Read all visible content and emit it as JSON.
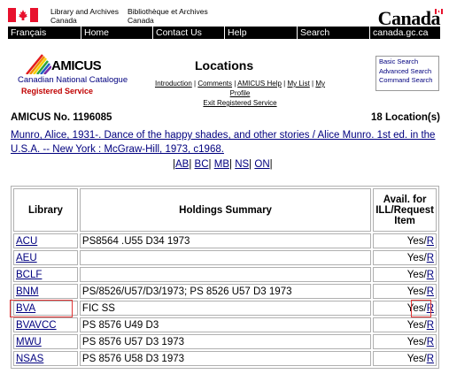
{
  "header": {
    "dept_en": [
      "Library and Archives",
      "Canada"
    ],
    "dept_fr": [
      "Bibliothèque et Archives",
      "Canada"
    ],
    "wordmark": "Canada"
  },
  "nav": [
    "Français",
    "Home",
    "Contact Us",
    "Help",
    "Search",
    "canada.gc.ca"
  ],
  "amicus": {
    "logo_text": "AMICUS",
    "logo_sub": "Canadian National Catalogue",
    "logo_service": "Registered Service",
    "title": "Locations",
    "links": [
      "Introduction",
      "Comments",
      "AMICUS Help",
      "My List",
      "My Profile",
      "Exit Registered Service"
    ],
    "search_links": [
      "Basic Search",
      "Advanced Search",
      "Command Search"
    ]
  },
  "record": {
    "number_label": "AMICUS No. 1196085",
    "location_count": "18 Location(s)",
    "citation": "Munro, Alice, 1931-. Dance of the happy shades, and other stories / Alice Munro. 1st ed. in the U.S.A. -- New York : McGraw-Hill, 1973, c1968.",
    "provinces": [
      "AB",
      "BC",
      "MB",
      "NS",
      "ON"
    ]
  },
  "table": {
    "headers": [
      "Library",
      "Holdings Summary",
      "Avail. for ILL/Request Item"
    ],
    "rows": [
      {
        "library": "ACU",
        "holdings": "PS8564 .U55 D34 1973",
        "avail": "Yes/",
        "request": "R"
      },
      {
        "library": "AEU",
        "holdings": "",
        "avail": "Yes/",
        "request": "R"
      },
      {
        "library": "BCLF",
        "holdings": "",
        "avail": "Yes/",
        "request": "R"
      },
      {
        "library": "BNM",
        "holdings": "PS/8526/U57/D3/1973; PS 8526 U57 D3 1973",
        "avail": "Yes/",
        "request": "R"
      },
      {
        "library": "BVA",
        "holdings": "FIC SS",
        "avail": "Yes/",
        "request": "R"
      },
      {
        "library": "BVAVCC",
        "holdings": "PS 8576 U49 D3",
        "avail": "Yes/",
        "request": "R"
      },
      {
        "library": "MWU",
        "holdings": "PS 8576 U57 D3 1973",
        "avail": "Yes/",
        "request": "R"
      },
      {
        "library": "NSAS",
        "holdings": "PS 8576 U58 D3 1973",
        "avail": "Yes/",
        "request": "R"
      }
    ]
  },
  "colors": {
    "link": "#00007f",
    "flag_red": "#e8112d",
    "highlight": "#e03535"
  }
}
